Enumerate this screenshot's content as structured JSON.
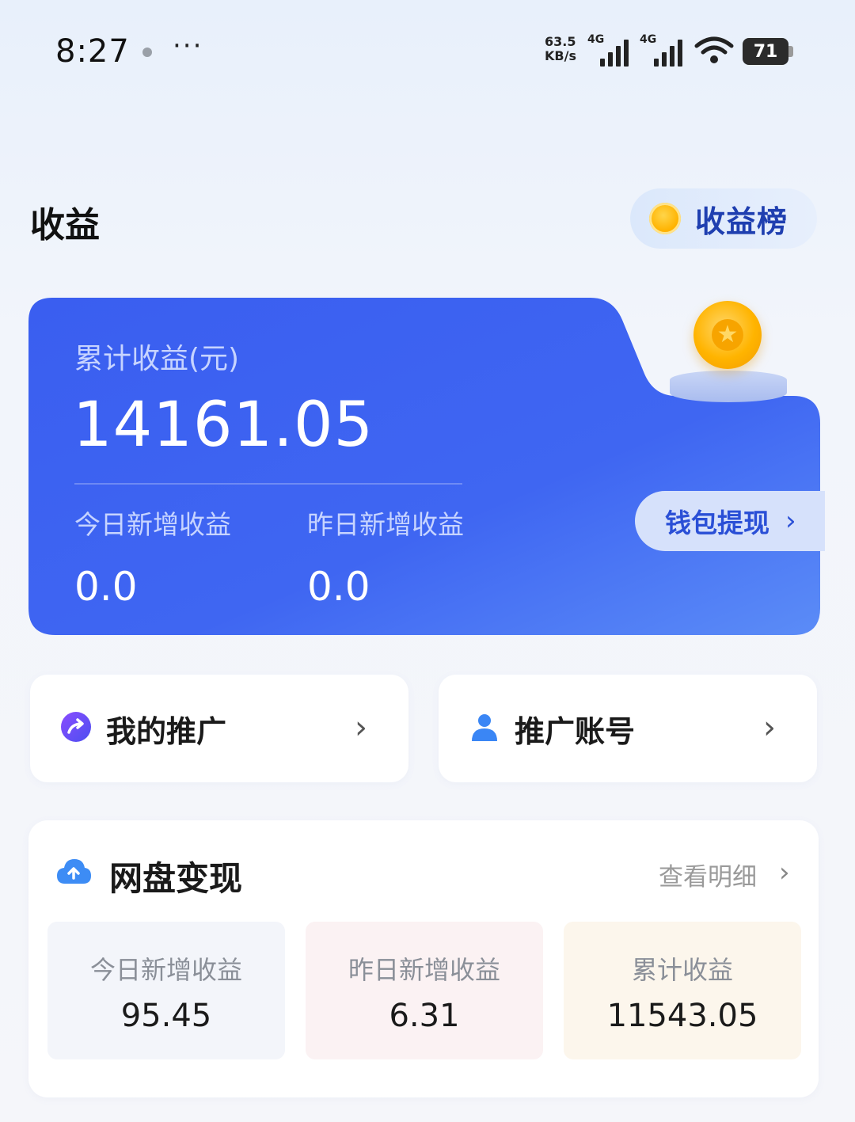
{
  "status_bar": {
    "time": "8:27",
    "more": "···",
    "speed_value": "63.5",
    "speed_unit": "KB/s",
    "net1": "4G",
    "net2": "4G",
    "battery": "71"
  },
  "header": {
    "title": "收益",
    "ranking_label": "收益榜"
  },
  "earnings_card": {
    "total_label": "累计收益(元)",
    "total_value": "14161.05",
    "today_label": "今日新增收益",
    "today_value": "0.0",
    "yesterday_label": "昨日新增收益",
    "yesterday_value": "0.0",
    "withdraw_label": "钱包提现",
    "colors": {
      "card_blue": "#3d63f0",
      "coin": "#ffb400"
    }
  },
  "nav": {
    "promotion_label": "我的推广",
    "promotion_icon": "share-arrow-icon",
    "account_label": "推广账号",
    "account_icon": "person-icon",
    "chevron": "›"
  },
  "netdisk": {
    "title": "网盘变现",
    "icon": "cloud-upload-icon",
    "detail_label": "查看明细",
    "tiles": [
      {
        "label": "今日新增收益",
        "value": "95.45"
      },
      {
        "label": "昨日新增收益",
        "value": "6.31"
      },
      {
        "label": "累计收益",
        "value": "11543.05"
      }
    ]
  }
}
